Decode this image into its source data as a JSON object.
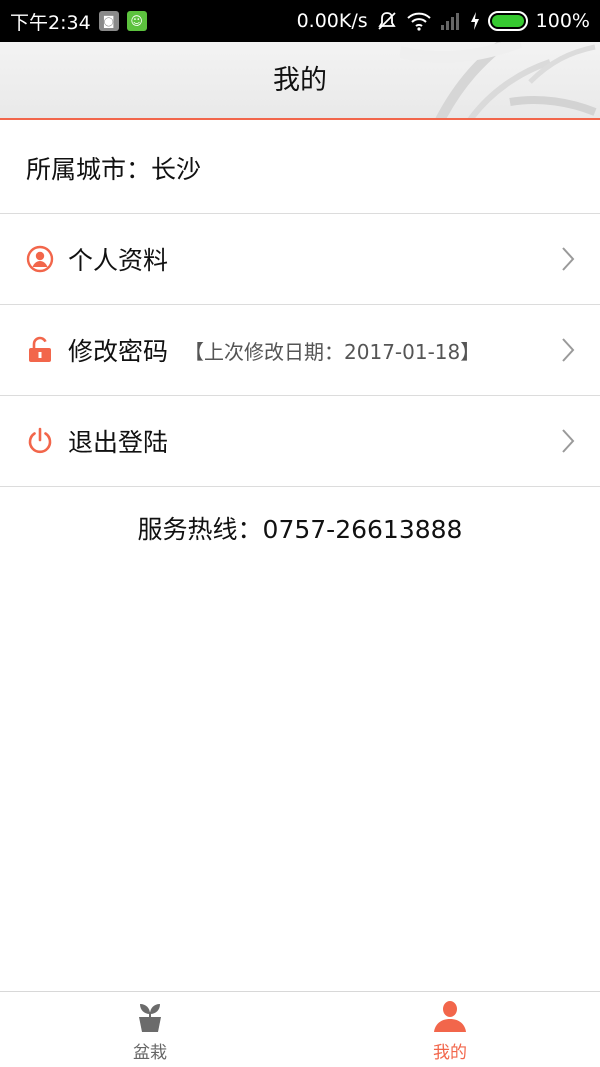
{
  "status_bar": {
    "time": "下午2:34",
    "net_speed": "0.00K/s",
    "battery_percent": "100%",
    "battery_level": 1.0,
    "icons": [
      "app-icon-gray",
      "app-icon-green",
      "mute-icon",
      "wifi-icon",
      "signal-icon",
      "charging-icon",
      "battery-icon"
    ]
  },
  "header": {
    "title": "我的"
  },
  "city": {
    "label": "所属城市：长沙"
  },
  "menu": {
    "profile": {
      "label": "个人资料",
      "icon": "user-circle-icon"
    },
    "password": {
      "label": "修改密码",
      "hint": "【上次修改日期：2017-01-18】",
      "icon": "unlock-icon"
    },
    "logout": {
      "label": "退出登陆",
      "icon": "power-icon"
    }
  },
  "hotline": "服务热线：0757-26613888",
  "tabs": [
    {
      "label": "盆栽",
      "icon": "plant-pot-icon",
      "active": false
    },
    {
      "label": "我的",
      "icon": "person-icon",
      "active": true
    }
  ],
  "colors": {
    "accent": "#f2664b",
    "status_bar_bg": "#000000",
    "divider": "#dcdcdc",
    "inactive_tab": "#666666"
  }
}
